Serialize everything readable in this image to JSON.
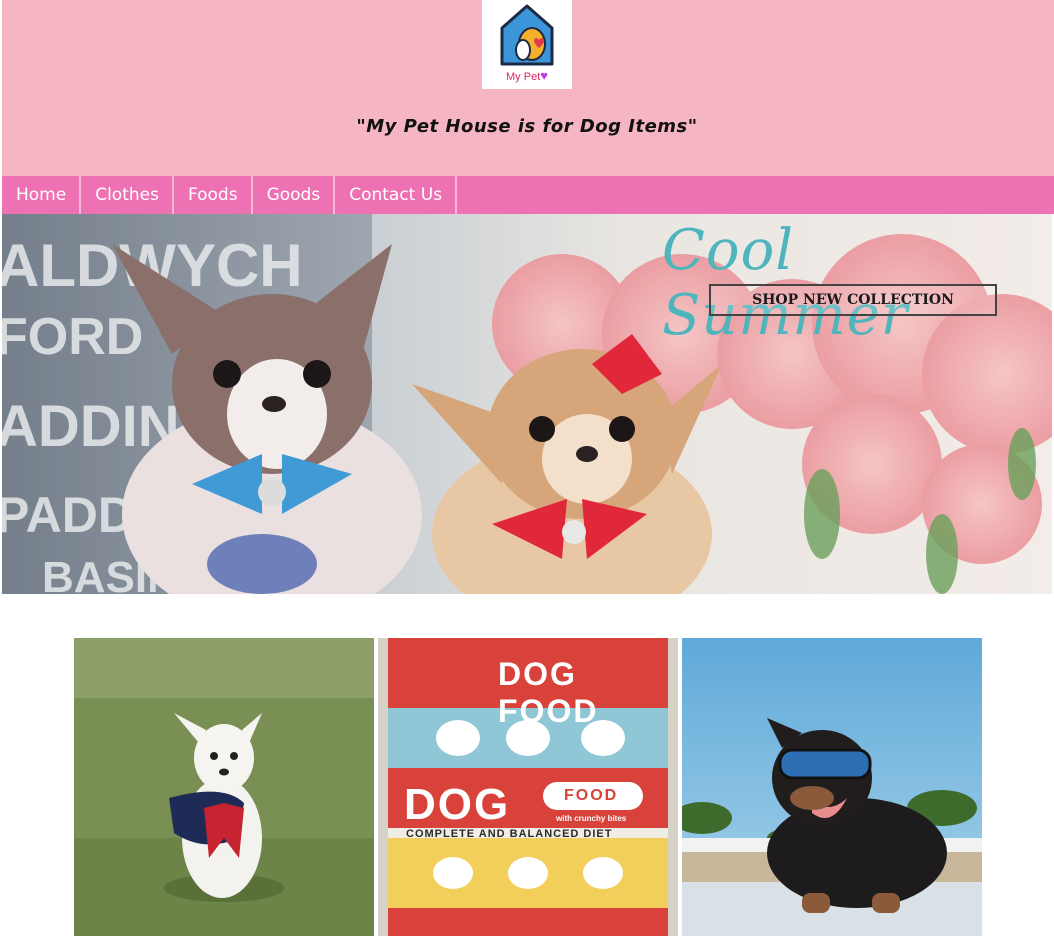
{
  "brand": {
    "logo_text": "My Pet",
    "logo_heart": "♥",
    "tagline": "\"My Pet House is for Dog Items\""
  },
  "nav": {
    "items": [
      {
        "label": "Home"
      },
      {
        "label": "Clothes"
      },
      {
        "label": "Foods"
      },
      {
        "label": "Goods"
      },
      {
        "label": "Contact Us"
      }
    ]
  },
  "hero": {
    "title": "Cool Summer",
    "cta": "SHOP NEW COLLECTION"
  },
  "gallery": {
    "tin_label_top": "DOG FOOD",
    "tin_label_big": "DOG",
    "tin_label_food": "FOOD",
    "tin_sub": "with crunchy bites",
    "tin_tagline": "COMPLETE AND BALANCED DIET"
  },
  "colors": {
    "header_bg": "#f5b5c2",
    "nav_bg": "#ee72b3",
    "nav_text": "#ffffff",
    "hero_title": "#4fb5bd"
  }
}
